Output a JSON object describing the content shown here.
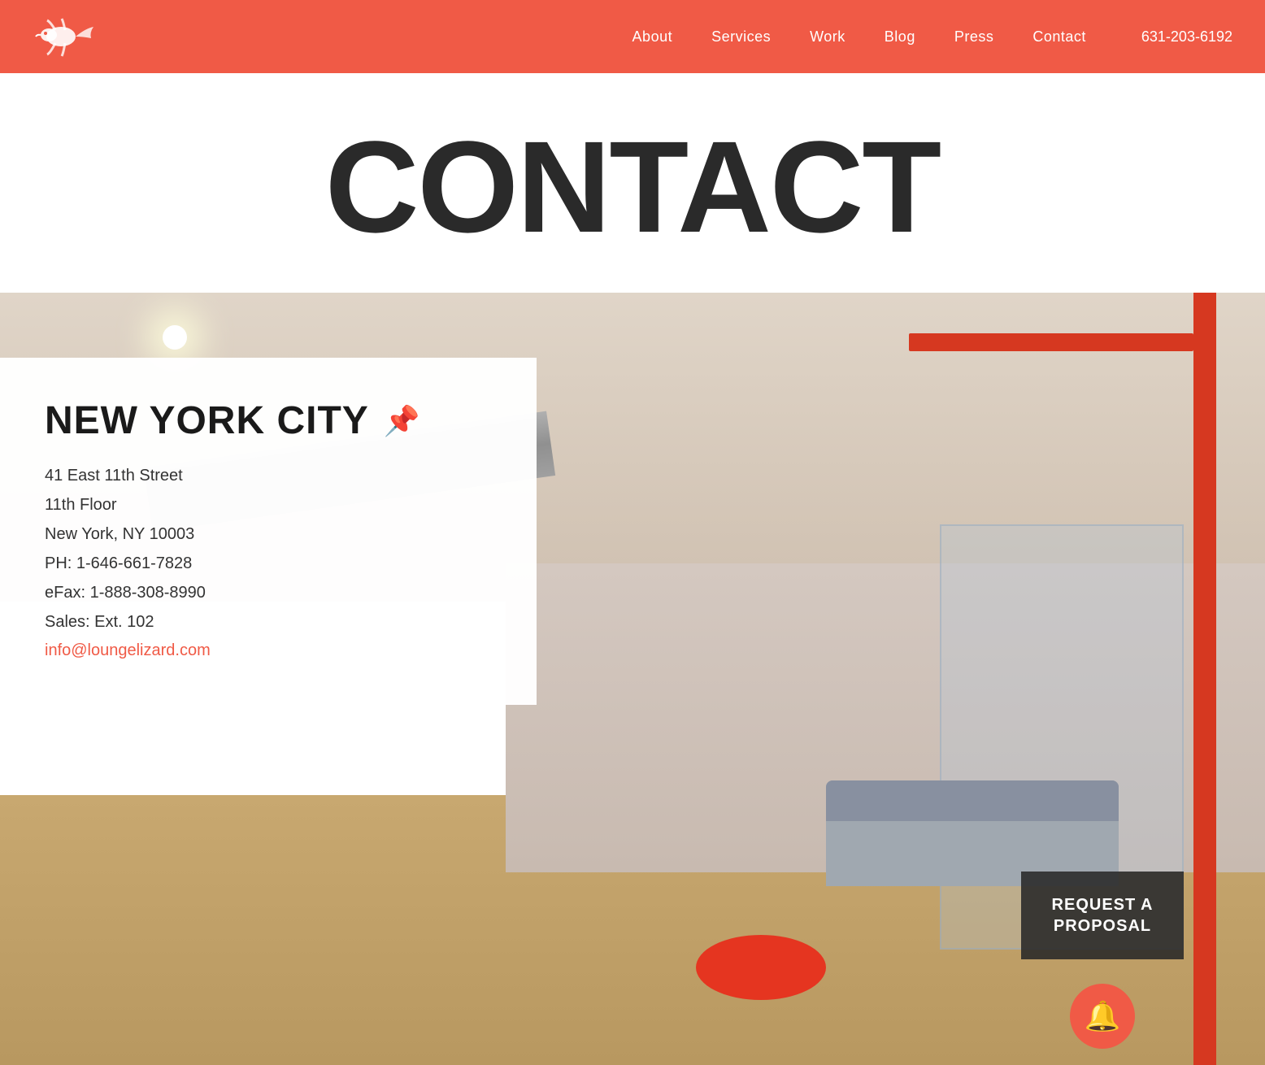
{
  "header": {
    "logo_alt": "Lounge Lizard Logo",
    "nav": {
      "about": "About",
      "services": "Services",
      "work": "Work",
      "blog": "Blog",
      "press": "Press",
      "contact": "Contact",
      "phone": "631-203-6192"
    }
  },
  "page": {
    "title": "CONTACT"
  },
  "contact_card": {
    "city": "NEW YORK CITY",
    "pin_icon": "📌",
    "address_line1": "41 East 11th Street",
    "address_line2": "11th Floor",
    "address_line3": "New York, NY 10003",
    "phone": "PH: 1-646-661-7828",
    "efax": "eFax: 1-888-308-8990",
    "sales": "Sales: Ext. 102",
    "email": "info@loungelizard.com"
  },
  "proposal_button": {
    "line1": "REQUEST A",
    "line2": "PROPOSAL"
  },
  "concierge_icon_unicode": "🔔"
}
